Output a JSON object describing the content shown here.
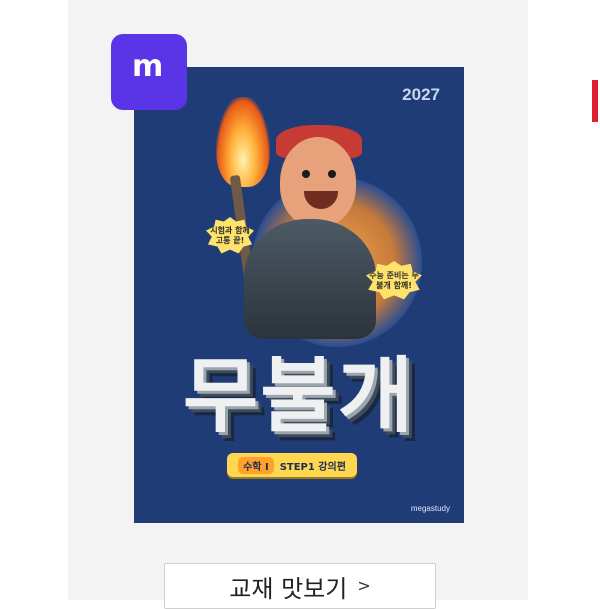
{
  "app": {
    "icon_name": "megastudy-app-icon",
    "icon_text": "m",
    "accent": "#5a35e7"
  },
  "book": {
    "year": "2027",
    "speech_left": "시험과 함께 고통 끝!",
    "speech_right": "수능 준비는 무불개 함께!",
    "title": "무불개",
    "subject": "수학 I",
    "step": "STEP1 강의편",
    "publisher": "megastudy"
  },
  "actions": {
    "preview_label": "교재 맛보기",
    "preview_arrow": ">"
  },
  "colors": {
    "cover_bg": "#1f3c77",
    "button_border": "#cfcfcf",
    "side_mark": "#e0202f"
  }
}
